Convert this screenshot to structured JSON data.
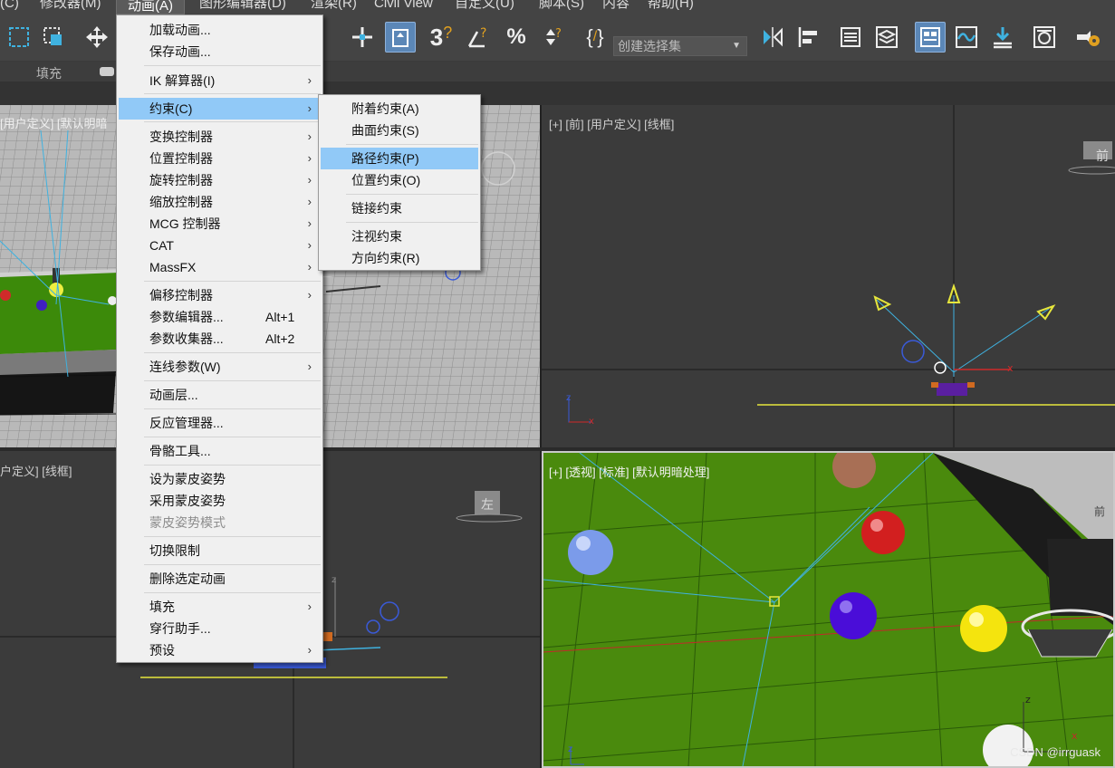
{
  "menubar": {
    "items": [
      {
        "label": "(C)"
      },
      {
        "label": "修改器(M)"
      },
      {
        "label": "动画(A)"
      },
      {
        "label": "图形编辑器(D)"
      },
      {
        "label": "渲染(R)"
      },
      {
        "label": "Civil View"
      },
      {
        "label": "自定义(U)"
      },
      {
        "label": "脚本(S)"
      },
      {
        "label": "内容"
      },
      {
        "label": "帮助(H)"
      }
    ]
  },
  "toolbar": {
    "selection_set_placeholder": "创建选择集"
  },
  "ribbon": {
    "fill_label": "填充"
  },
  "animation_menu": {
    "items": [
      {
        "label": "加载动画..."
      },
      {
        "label": "保存动画..."
      },
      {
        "label": "IK 解算器(I)",
        "submenu": true
      },
      {
        "label": "约束(C)",
        "submenu": true,
        "highlighted": true
      },
      {
        "label": "变换控制器",
        "submenu": true
      },
      {
        "label": "位置控制器",
        "submenu": true
      },
      {
        "label": "旋转控制器",
        "submenu": true
      },
      {
        "label": "缩放控制器",
        "submenu": true
      },
      {
        "label": "MCG 控制器",
        "submenu": true
      },
      {
        "label": "CAT",
        "submenu": true
      },
      {
        "label": "MassFX",
        "submenu": true
      },
      {
        "label": "偏移控制器",
        "submenu": true
      },
      {
        "label": "参数编辑器...",
        "shortcut": "Alt+1"
      },
      {
        "label": "参数收集器...",
        "shortcut": "Alt+2"
      },
      {
        "label": "连线参数(W)",
        "submenu": true
      },
      {
        "label": "动画层..."
      },
      {
        "label": "反应管理器..."
      },
      {
        "label": "骨骼工具..."
      },
      {
        "label": "设为蒙皮姿势"
      },
      {
        "label": "采用蒙皮姿势"
      },
      {
        "label": "蒙皮姿势模式",
        "disabled": true
      },
      {
        "label": "切换限制"
      },
      {
        "label": "删除选定动画"
      },
      {
        "label": "填充",
        "submenu": true
      },
      {
        "label": "穿行助手..."
      },
      {
        "label": "预设",
        "submenu": true
      }
    ]
  },
  "constraints_menu": {
    "items": [
      {
        "label": "附着约束(A)"
      },
      {
        "label": "曲面约束(S)"
      },
      {
        "label": "路径约束(P)",
        "highlighted": true
      },
      {
        "label": "位置约束(O)"
      },
      {
        "label": "链接约束"
      },
      {
        "label": "注视约束"
      },
      {
        "label": "方向约束(R)"
      }
    ]
  },
  "viewports": {
    "top_left": {
      "label": "[用户定义] [默认明暗"
    },
    "top_right": {
      "label": "[+] [前] [用户定义] [线框]",
      "cube_label": "前"
    },
    "bottom_left": {
      "label": "户定义] [线框]",
      "cube_label": "左"
    },
    "bottom_right": {
      "label": "[+] [透视] [标准] [默认明暗处理]",
      "cube_label": "前"
    }
  },
  "watermark": "CSDN @irrguask",
  "colors": {
    "menu_bg": "#f0f0f0",
    "menu_highlight": "#91c9f7",
    "grass": "#4a8a0d",
    "ui_dark": "#444444"
  }
}
